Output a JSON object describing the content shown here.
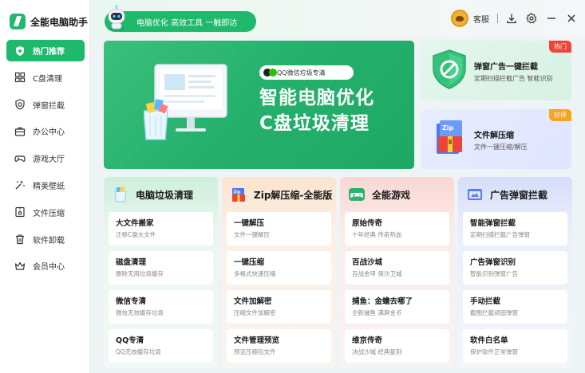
{
  "app": {
    "name": "全能电脑助手"
  },
  "sidebar": {
    "items": [
      {
        "label": "热门推荐",
        "icon": "shield-icon",
        "active": true
      },
      {
        "label": "C盘清理",
        "icon": "grid-icon"
      },
      {
        "label": "弹窗拦截",
        "icon": "block-icon"
      },
      {
        "label": "办公中心",
        "icon": "briefcase-icon"
      },
      {
        "label": "游戏大厅",
        "icon": "gamepad-icon"
      },
      {
        "label": "精美壁纸",
        "icon": "wallpaper-icon"
      },
      {
        "label": "文件压缩",
        "icon": "archive-icon"
      },
      {
        "label": "软件卸载",
        "icon": "trash-icon"
      },
      {
        "label": "会员中心",
        "icon": "crown-icon"
      }
    ]
  },
  "topbar": {
    "slogan": "电脑优化 高效工具 一触即达",
    "service_label": "客服"
  },
  "banner": {
    "tag": "QQ微信垃圾专清",
    "title": "智能电脑优化",
    "subtitle": "C盘垃圾清理"
  },
  "promos": [
    {
      "badge": "热门",
      "title": "弹窗广告一键拦截",
      "desc": "定期扫描拦截广告 智能识别"
    },
    {
      "badge": "好评",
      "title": "文件解压缩",
      "desc": "文件一键压缩/解压"
    }
  ],
  "columns": [
    {
      "title": "电脑垃圾清理",
      "cards": [
        {
          "title": "大文件搬家",
          "desc": "迁移C盘大文件"
        },
        {
          "title": "磁盘清理",
          "desc": "删除无用垃圾缓存"
        },
        {
          "title": "微信专清",
          "desc": "微信无效缓存垃圾"
        },
        {
          "title": "QQ专清",
          "desc": "QQ无效缓存垃圾"
        }
      ]
    },
    {
      "title": "Zip解压缩-全能版",
      "cards": [
        {
          "title": "一键解压",
          "desc": "文件一键解压"
        },
        {
          "title": "一键压缩",
          "desc": "多格式快速压缩"
        },
        {
          "title": "文件加解密",
          "desc": "压缩文件加解密"
        },
        {
          "title": "文件管理预览",
          "desc": "预览压缩包文件"
        }
      ]
    },
    {
      "title": "全能游戏",
      "cards": [
        {
          "title": "原始传奇",
          "desc": "十年经典 传奇热血"
        },
        {
          "title": "百战沙城",
          "desc": "百战金甲 保沙卫城"
        },
        {
          "title": "捕鱼：金蟾去哪了",
          "desc": "全新捕鱼 满屏金币"
        },
        {
          "title": "维京传奇",
          "desc": "决战沙城 经典复刻"
        }
      ]
    },
    {
      "title": "广告弹窗拦截",
      "cards": [
        {
          "title": "智能弹窗拦截",
          "desc": "定期扫描拦截广告弹窗"
        },
        {
          "title": "广告弹窗识别",
          "desc": "智能识别弹窗广告"
        },
        {
          "title": "手动拦截",
          "desc": "截图拦截顽固弹窗"
        },
        {
          "title": "软件白名单",
          "desc": "保护软件正常弹窗"
        }
      ]
    }
  ],
  "colors": {
    "brand_green": "#1fb96c",
    "hot_red": "#f04438",
    "good_orange": "#f5a524"
  }
}
